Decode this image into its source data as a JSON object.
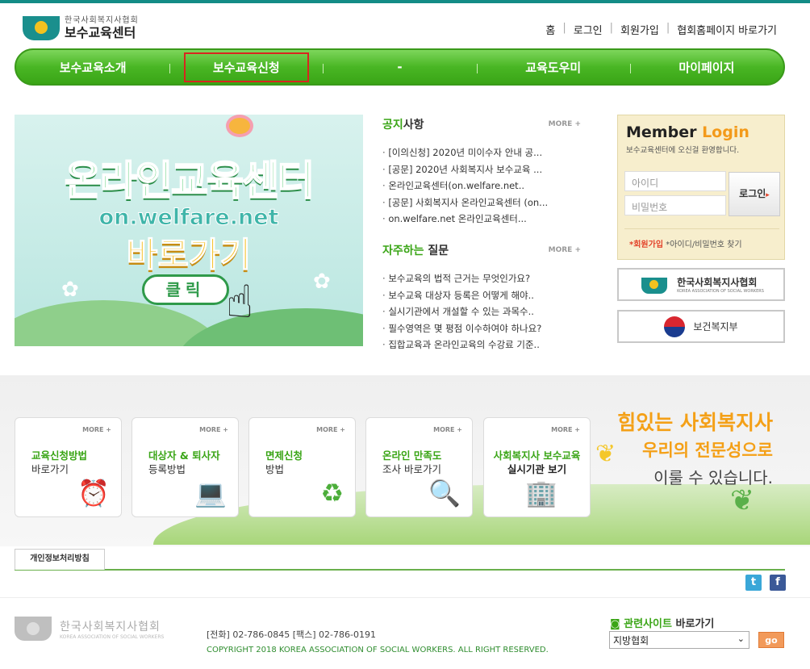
{
  "header": {
    "logo_small": "한국사회복지사협회",
    "logo_big": "보수교육센터",
    "util": [
      "홈",
      "로그인",
      "회원가입",
      "협회홈페이지 바로가기"
    ]
  },
  "gnb": [
    "보수교육소개",
    "보수교육신청",
    "-",
    "교육도우미",
    "마이페이지"
  ],
  "banner": {
    "title": "온라인교육센터",
    "url": "on.welfare.net",
    "go": "바로가기",
    "click": "클릭"
  },
  "notice": {
    "title_green": "공지",
    "title_rest": "사항",
    "more": "MORE +",
    "items": [
      "[이의신청] 2020년 미이수자 안내 공...",
      "[공문] 2020년 사회복지사 보수교육 ...",
      "온라인교육센터(on.welfare.net..",
      "[공문] 사회복지사 온라인교육센터 (on...",
      "on.welfare.net 온라인교육센터..."
    ]
  },
  "faq": {
    "title_green": "자주하는",
    "title_rest": " 질문",
    "more": "MORE +",
    "items": [
      "보수교육의 법적 근거는 무엇인가요?",
      "보수교육 대상자 등록은 어떻게 해야..",
      "실시기관에서 개설할 수 있는 과목수..",
      "필수영역은 몇 평점 이수하여야 하나요?",
      "집합교육과 온라인교육의 수강료 기준.."
    ]
  },
  "login": {
    "title_a": "Member",
    "title_b": "Login",
    "sub": "보수교육센터에 오신걸 환영합니다.",
    "id_placeholder": "아이디",
    "pw_placeholder": "비밀번호",
    "button": "로그인",
    "join": "*회원가입",
    "find": "*아이디/비밀번호 찾기"
  },
  "site_buttons": {
    "kasw_name": "한국사회복지사협회",
    "kasw_en": "KOREA ASSOCIATION OF SOCIAL WORKERS",
    "mohw": "보건복지부"
  },
  "quick": [
    {
      "l1": "교육신청방법",
      "l2": "바로가기",
      "icon": "clock-icon"
    },
    {
      "l1": "대상자 & 퇴사자",
      "l2": "등록방법",
      "icon": "laptop-icon"
    },
    {
      "l1": "면제신청",
      "l2": "방법",
      "icon": "recycle-icon"
    },
    {
      "l1": "온라인 만족도",
      "l2": "조사 바로가기",
      "icon": "survey-icon"
    },
    {
      "l1": "사회복지사 보수교육",
      "l2": "실시기관 보기",
      "icon": "building-icon"
    }
  ],
  "quick_more": "MORE +",
  "slogan": {
    "a": "힘있는 사회복지사",
    "b": "우리의 전문성으로",
    "c": "이룰 수 있습니다."
  },
  "footer": {
    "tab": "개인정보처리방침",
    "logo_name": "한국사회복지사협회",
    "logo_en": "KOREA ASSOCIATION OF SOCIAL WORKERS",
    "phone": "[전화] 02-786-0845   [팩스] 02-786-0191",
    "copyright": "COPYRIGHT 2018 KOREA ASSOCIATION OF SOCIAL WORKERS. ALL RIGHT RESERVED.",
    "related_green": "관련사이트",
    "related_rest": " 바로가기",
    "select_value": "지방협회",
    "go": "go"
  },
  "colors": {
    "accent": "#3aa516",
    "teal": "#138c86",
    "orange": "#f4a017"
  }
}
